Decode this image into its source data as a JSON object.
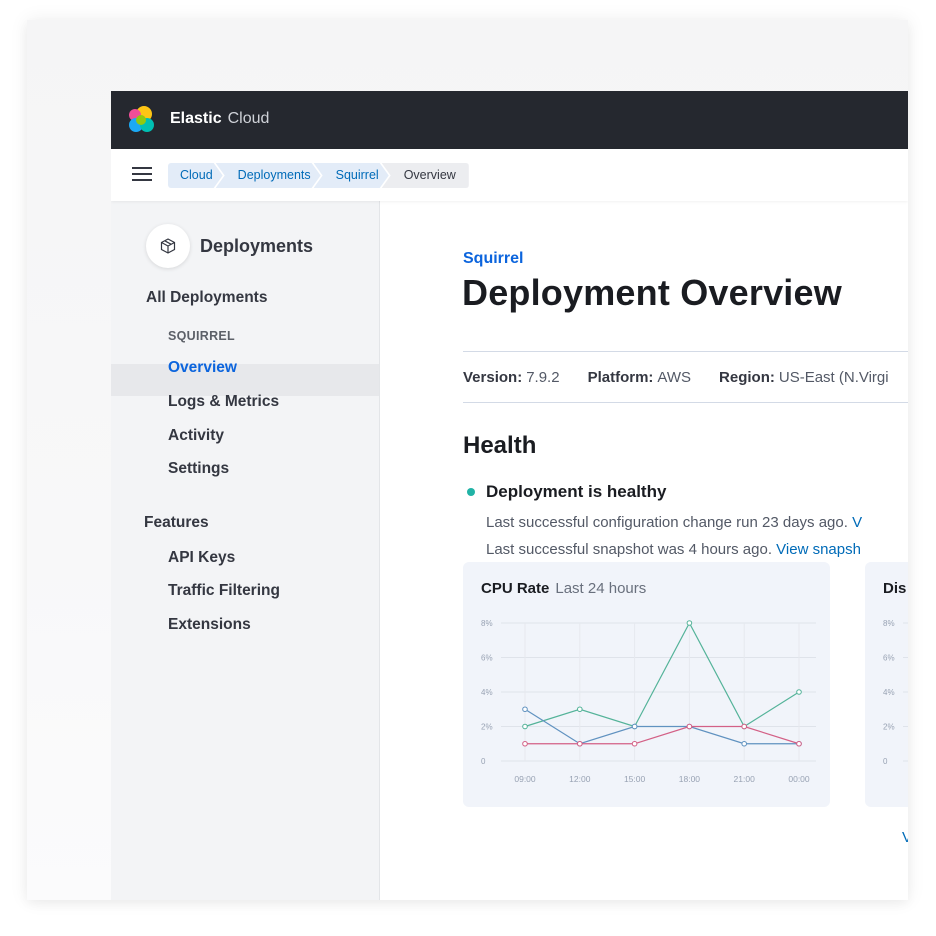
{
  "header": {
    "brand_bold": "Elastic",
    "brand_light": "Cloud"
  },
  "breadcrumbs": [
    {
      "label": "Cloud"
    },
    {
      "label": "Deployments"
    },
    {
      "label": "Squirrel"
    },
    {
      "label": "Overview"
    }
  ],
  "sidebar": {
    "title": "Deployments",
    "all_deployments": "All Deployments",
    "deployment_name": "SQUIRREL",
    "items": [
      {
        "label": "Overview",
        "active": true
      },
      {
        "label": "Logs & Metrics"
      },
      {
        "label": "Activity"
      },
      {
        "label": "Settings"
      }
    ],
    "features_label": "Features",
    "features": [
      {
        "label": "API Keys"
      },
      {
        "label": "Traffic Filtering"
      },
      {
        "label": "Extensions"
      }
    ]
  },
  "main": {
    "deployment_link": "Squirrel",
    "title": "Deployment Overview",
    "meta": {
      "version_label": "Version:",
      "version": "7.9.2",
      "platform_label": "Platform:",
      "platform": "AWS",
      "region_label": "Region:",
      "region": "US-East (N.Virgi"
    },
    "health_heading": "Health",
    "status": "Deployment is healthy",
    "config_line": "Last successful configuration change run 23 days ago. ",
    "config_link": "V",
    "snapshot_line": "Last successful snapshot was 4 hours ago. ",
    "snapshot_link": "View snapsh",
    "bottom_link": "V",
    "second_panel_title": "Dis"
  },
  "chart_data": [
    {
      "type": "line",
      "title": "CPU Rate",
      "subtitle": "Last 24 hours",
      "categories": [
        "09:00",
        "12:00",
        "15:00",
        "18:00",
        "21:00",
        "00:00"
      ],
      "y_ticks": [
        "0",
        "2%",
        "4%",
        "6%",
        "8%"
      ],
      "ylim": [
        0,
        8
      ],
      "series": [
        {
          "color": "#54b399",
          "values": [
            2,
            3,
            2,
            8,
            2,
            4
          ]
        },
        {
          "color": "#6092c0",
          "values": [
            3,
            1,
            2,
            2,
            1,
            1
          ]
        },
        {
          "color": "#d36086",
          "values": [
            1,
            1,
            1,
            2,
            2,
            1
          ]
        }
      ]
    },
    {
      "type": "line",
      "title": "Dis",
      "y_ticks": [
        "0",
        "2%",
        "4%",
        "6%",
        "8%"
      ],
      "ylim": [
        0,
        8
      ],
      "series": []
    }
  ],
  "colors": {
    "accent": "#0b64dd",
    "healthy": "#21b3a6",
    "topbar": "#25282f"
  }
}
